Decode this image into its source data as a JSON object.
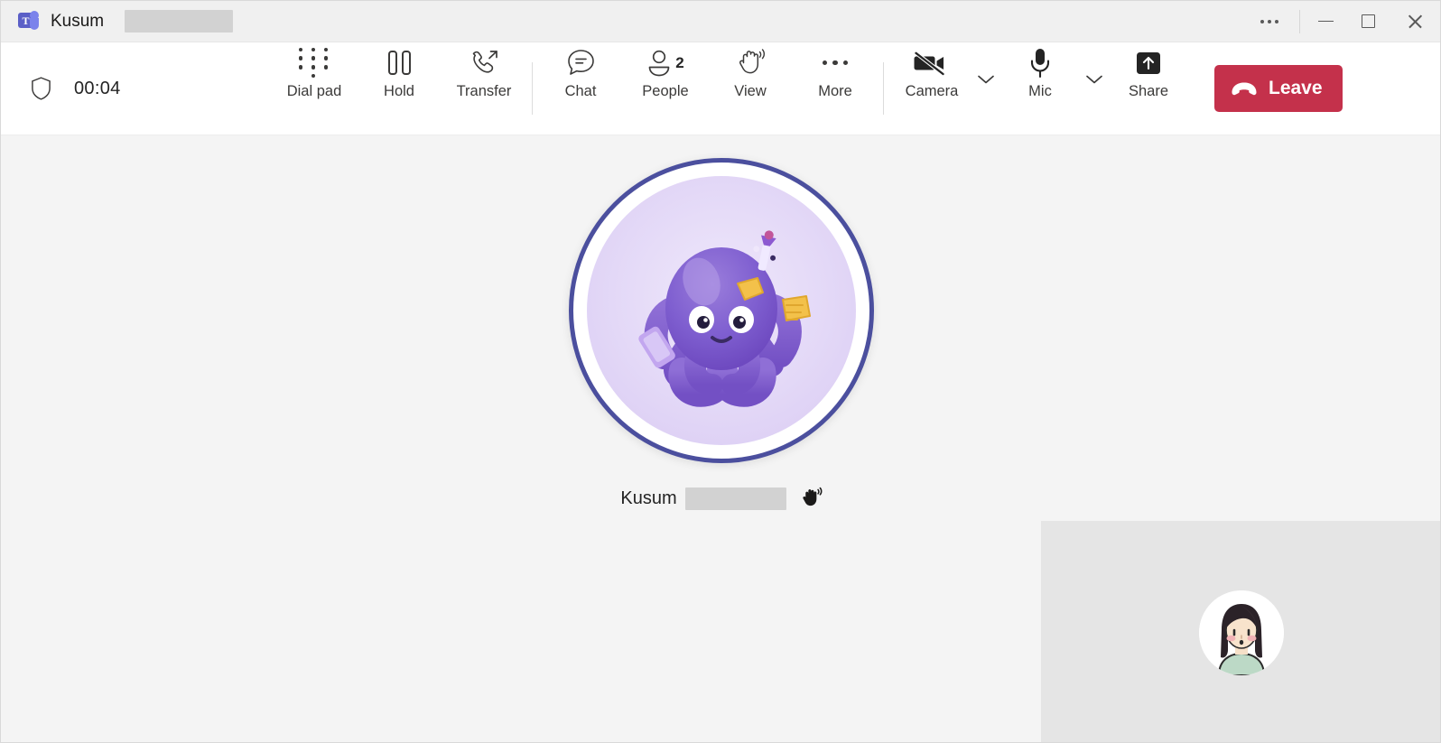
{
  "window": {
    "app_icon": "teams-logo",
    "title": "Kusum",
    "title_redacted": true,
    "controls": {
      "more_label": "More options",
      "minimize_label": "Minimize",
      "maximize_label": "Maximize",
      "close_label": "Close"
    }
  },
  "call_toolbar": {
    "security_icon": "shield-icon",
    "timer": "00:04",
    "buttons": [
      {
        "id": "dial-pad",
        "label": "Dial pad",
        "icon": "dial-pad-icon"
      },
      {
        "id": "hold",
        "label": "Hold",
        "icon": "pause-icon"
      },
      {
        "id": "transfer",
        "label": "Transfer",
        "icon": "call-transfer-icon"
      },
      {
        "id": "chat",
        "label": "Chat",
        "icon": "chat-bubble-icon"
      },
      {
        "id": "people",
        "label": "People",
        "icon": "person-icon",
        "badge": "2"
      },
      {
        "id": "view",
        "label": "View",
        "icon": "raised-hand-icon"
      },
      {
        "id": "more",
        "label": "More",
        "icon": "more-dots-icon"
      },
      {
        "id": "camera",
        "label": "Camera",
        "icon": "camera-off-icon",
        "state": "off",
        "has_dropdown": true
      },
      {
        "id": "mic",
        "label": "Mic",
        "icon": "microphone-icon",
        "state": "on",
        "has_dropdown": true
      },
      {
        "id": "share",
        "label": "Share",
        "icon": "share-screen-icon"
      }
    ],
    "leave": {
      "label": "Leave",
      "icon": "hangup-icon",
      "color": "#c4314b"
    }
  },
  "stage": {
    "main_participant": {
      "name": "Kusum",
      "name_redacted": true,
      "avatar_icon": "octopus-avatar",
      "hand_raised": true,
      "hand_icon": "raised-hand-filled-icon"
    },
    "self_view": {
      "avatar_icon": "woman-avatar",
      "background_color": "#e5e5e5"
    },
    "background_color": "#f4f4f4"
  }
}
